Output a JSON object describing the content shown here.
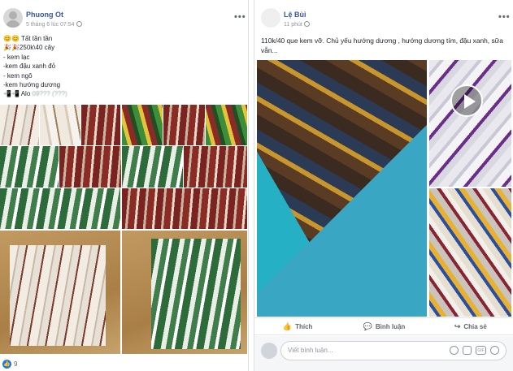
{
  "left_post": {
    "author": "Phuong Ot",
    "timestamp": "5 tháng 6 lúc 07:54",
    "lines": [
      "Tất tần tần",
      "250k\\40 cây",
      "- kem lạc",
      "-kem đậu xanh đỏ",
      "- kem ngô",
      "-kem hướng dương",
      "Alo"
    ],
    "emoji_line1": "😊😊",
    "emoji_line2": "🎉🎉",
    "emoji_line7": "📲📲",
    "phone_blurred": "09??? (???)",
    "like_count": "9"
  },
  "right_post": {
    "author": "Lệ Bùi",
    "timestamp": "11 phút",
    "text": "110k/40 que kem vỡ. Chủ yếu hướng dương , hướng dương tím, đậu xanh, sữa vẫn...",
    "actions": {
      "like": "Thích",
      "comment": "Bình luận",
      "share": "Chia sẻ"
    },
    "comment_placeholder": "Viết bình luận..."
  },
  "colors": {
    "link": "#385898",
    "meta": "#90949c",
    "like_blue": "#1877f2"
  }
}
